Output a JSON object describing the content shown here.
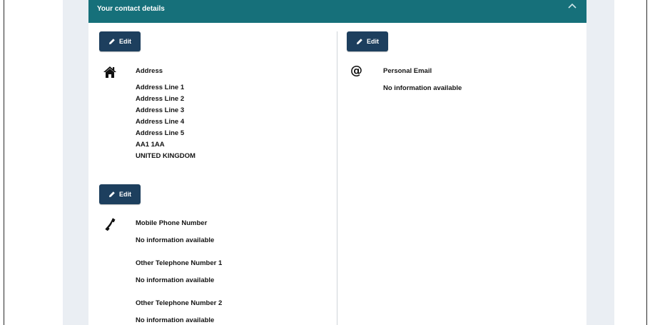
{
  "section": {
    "title": "Your contact details"
  },
  "buttons": {
    "edit_label": "Edit"
  },
  "address": {
    "label": "Address",
    "lines": [
      "Address Line 1",
      "Address Line 2",
      "Address Line 3",
      "Address Line 4",
      "Address Line 5",
      "AA1 1AA",
      "UNITED KINGDOM"
    ]
  },
  "phones": [
    {
      "label": "Mobile Phone Number",
      "value": "No information available"
    },
    {
      "label": "Other Telephone Number 1",
      "value": "No information available"
    },
    {
      "label": "Other Telephone Number 2",
      "value": "No information available"
    }
  ],
  "email": {
    "label": "Personal Email",
    "value": "No information available"
  },
  "colors": {
    "header": "#16707a",
    "button": "#1d3f5e",
    "background": "#eaeef3"
  },
  "icons": {
    "collapse": "chevron-up-icon",
    "edit": "pencil-icon",
    "address": "home-icon",
    "phone": "phone-icon",
    "email": "at-icon"
  }
}
